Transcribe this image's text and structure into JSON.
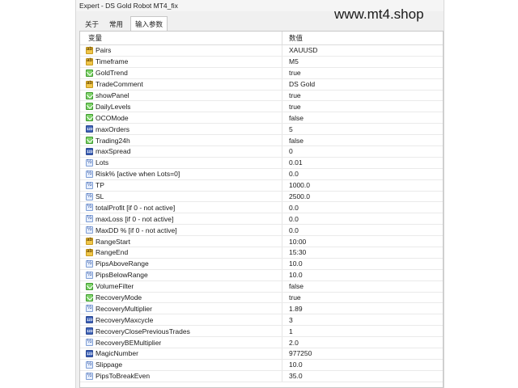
{
  "window": {
    "title": "Expert - DS Gold Robot MT4_fix"
  },
  "watermark": "www.mt4.shop",
  "tabs": [
    {
      "label": "关于",
      "active": false
    },
    {
      "label": "常用",
      "active": false
    },
    {
      "label": "输入参数",
      "active": true
    }
  ],
  "table": {
    "headers": {
      "name": "变量",
      "value": "数值"
    },
    "rows": [
      {
        "type": "ab",
        "name": "Pairs",
        "value": "XAUUSD"
      },
      {
        "type": "ab",
        "name": "Timeframe",
        "value": "M5"
      },
      {
        "type": "bool",
        "name": "GoldTrend",
        "value": "true"
      },
      {
        "type": "ab",
        "name": "TradeComment",
        "value": "DS Gold"
      },
      {
        "type": "bool",
        "name": "showPanel",
        "value": "true"
      },
      {
        "type": "bool",
        "name": "DailyLevels",
        "value": "true"
      },
      {
        "type": "bool",
        "name": "OCOMode",
        "value": "false"
      },
      {
        "type": "int",
        "name": "maxOrders",
        "value": "5"
      },
      {
        "type": "bool",
        "name": "Trading24h",
        "value": "false"
      },
      {
        "type": "int",
        "name": "maxSpread",
        "value": "0"
      },
      {
        "type": "dbl",
        "name": "Lots",
        "value": "0.01"
      },
      {
        "type": "dbl",
        "name": "Risk% [active when Lots=0]",
        "value": "0.0"
      },
      {
        "type": "dbl",
        "name": "TP",
        "value": "1000.0"
      },
      {
        "type": "dbl",
        "name": "SL",
        "value": "2500.0"
      },
      {
        "type": "dbl",
        "name": "totalProfit [if 0 - not active]",
        "value": "0.0"
      },
      {
        "type": "dbl",
        "name": "maxLoss [if 0 - not active]",
        "value": "0.0"
      },
      {
        "type": "dbl",
        "name": "MaxDD % [if 0 - not active]",
        "value": "0.0"
      },
      {
        "type": "ab",
        "name": "RangeStart",
        "value": "10:00"
      },
      {
        "type": "ab",
        "name": "RangeEnd",
        "value": "15:30"
      },
      {
        "type": "dbl",
        "name": "PipsAboveRange",
        "value": "10.0"
      },
      {
        "type": "dbl",
        "name": "PipsBelowRange",
        "value": "10.0"
      },
      {
        "type": "bool",
        "name": "VolumeFilter",
        "value": "false"
      },
      {
        "type": "bool",
        "name": "RecoveryMode",
        "value": "true"
      },
      {
        "type": "dbl",
        "name": "RecoveryMultiplier",
        "value": "1.89"
      },
      {
        "type": "int",
        "name": "RecoveryMaxcycle",
        "value": "3"
      },
      {
        "type": "int",
        "name": "RecoveryClosePreviousTrades",
        "value": "1"
      },
      {
        "type": "dbl",
        "name": "RecoveryBEMultiplier",
        "value": "2.0"
      },
      {
        "type": "int",
        "name": "MagicNumber",
        "value": "977250"
      },
      {
        "type": "dbl",
        "name": "Slippage",
        "value": "10.0"
      },
      {
        "type": "dbl",
        "name": "PipsToBreakEven",
        "value": "35.0"
      }
    ]
  }
}
